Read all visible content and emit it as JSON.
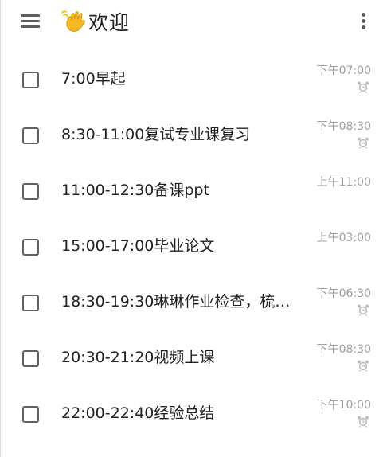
{
  "header": {
    "menu_icon": "hamburger-menu-icon",
    "title_icon": "waving-hand-icon",
    "title": "欢迎",
    "more_icon": "more-vertical-icon"
  },
  "tasks": [
    {
      "title": "7:00早起",
      "time": "下午07:00",
      "alarm": true
    },
    {
      "title": "8:30-11:00复试专业课复习",
      "time": "下午08:30",
      "alarm": true
    },
    {
      "title": "11:00-12:30备课ppt",
      "time": "上午11:00",
      "alarm": false
    },
    {
      "title": "15:00-17:00毕业论文",
      "time": "上午03:00",
      "alarm": false
    },
    {
      "title": "18:30-19:30琳琳作业检查，梳…",
      "time": "下午06:30",
      "alarm": true
    },
    {
      "title": "20:30-21:20视频上课",
      "time": "下午08:30",
      "alarm": true
    },
    {
      "title": "22:00-22:40经验总结",
      "time": "下午10:00",
      "alarm": true
    }
  ],
  "colors": {
    "icon_gray": "#5f5f5f",
    "time_gray": "#9e9e9e",
    "alarm_gray": "#bdbdbd",
    "text": "#212121"
  }
}
